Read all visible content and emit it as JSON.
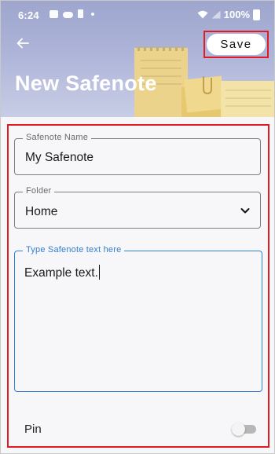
{
  "status_bar": {
    "time": "6:24",
    "battery": "100%"
  },
  "header": {
    "title": "New Safenote",
    "save_label": "Save",
    "back_icon": "arrow-left-icon"
  },
  "form": {
    "name": {
      "label": "Safenote Name",
      "value": "My Safenote"
    },
    "folder": {
      "label": "Folder",
      "value": "Home",
      "icon": "chevron-down-icon"
    },
    "text": {
      "label": "Type Safenote text here",
      "value": "Example text."
    },
    "pin": {
      "label": "Pin",
      "enabled": false
    }
  },
  "colors": {
    "header_gradient_top": "#9ea6ce",
    "header_gradient_bottom": "#c8cde6",
    "focus_blue": "#2f7fd3",
    "highlight_red": "#e01b24"
  }
}
